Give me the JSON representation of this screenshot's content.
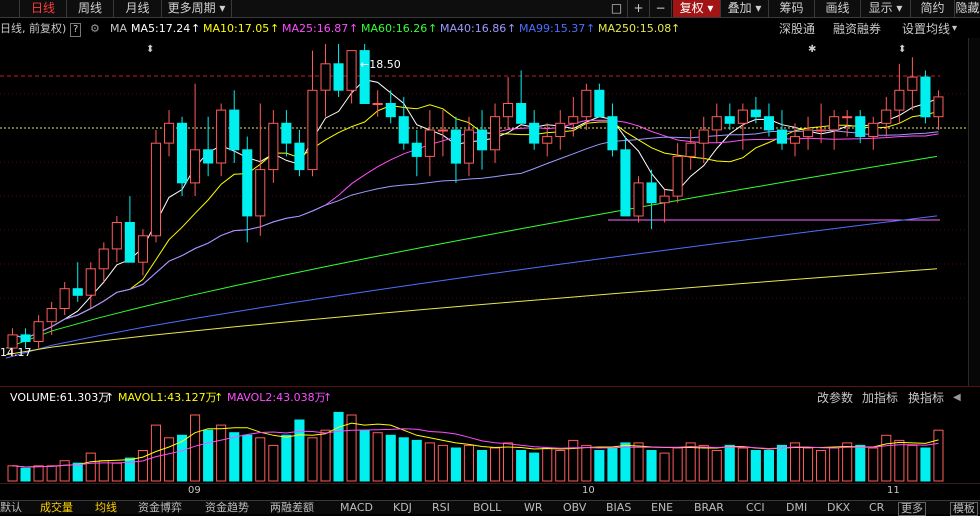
{
  "toolbar": {
    "left_cut": "",
    "tabs": [
      {
        "label": "日线",
        "active": true
      },
      {
        "label": "周线",
        "active": false
      },
      {
        "label": "月线",
        "active": false
      },
      {
        "label": "更多周期",
        "active": false
      }
    ],
    "more_arrow": "▾",
    "square_icon": "□",
    "plus": "+",
    "minus": "−",
    "fuquan": "复权",
    "dropdown_arrow": "▾",
    "overlay": "叠加",
    "chips": "筹码",
    "draw": "画线",
    "display": "显示",
    "simple": "简约",
    "hide": "隐藏"
  },
  "ma_legend": {
    "prefix": "日线, 前复权)",
    "help": "?",
    "label": "MA",
    "items": [
      {
        "text": "MA5:17.24",
        "color": "#ffffff"
      },
      {
        "text": "MA10:17.05",
        "color": "#ffff00"
      },
      {
        "text": "MA25:16.87",
        "color": "#ff4dff"
      },
      {
        "text": "MA60:16.26",
        "color": "#33ff33"
      },
      {
        "text": "MA40:16.86",
        "color": "#9b9bff"
      },
      {
        "text": "MA99:15.37",
        "color": "#4d6fff"
      },
      {
        "text": "MA250:15.08",
        "color": "#e8e84d"
      }
    ],
    "arrow": "↑",
    "right_links": [
      "深股通",
      "融资融券",
      "设置均线"
    ]
  },
  "price_labels": {
    "high": "18.50",
    "low": "14.17"
  },
  "volume_legend": {
    "volume": "VOLUME:61.303万",
    "mavol1": "MAVOL1:43.127万",
    "mavol2": "MAVOL2:43.038万",
    "links": [
      "改参数",
      "加指标",
      "换指标"
    ]
  },
  "dates": [
    "09",
    "10",
    "11"
  ],
  "bottom_tabs": [
    "默认",
    "成交量",
    "均线",
    "资金博弈",
    "资金趋势",
    "两融差额",
    "MACD",
    "KDJ",
    "RSI",
    "BOLL",
    "WR",
    "OBV",
    "BIAS",
    "ENE",
    "BRAR",
    "CCI",
    "DMI",
    "DKX",
    "CR",
    "更多",
    "模板"
  ],
  "bottom_active": [
    "成交量",
    "均线"
  ],
  "colors": {
    "up": "#ff5b5b",
    "down": "#00f0f0",
    "accent": "#a31414"
  },
  "chart_data": {
    "type": "candlestick",
    "ohlc": [
      [
        14.3,
        14.6,
        14.17,
        14.5
      ],
      [
        14.5,
        14.6,
        14.3,
        14.4
      ],
      [
        14.4,
        14.8,
        14.3,
        14.7
      ],
      [
        14.7,
        15.0,
        14.5,
        14.9
      ],
      [
        14.9,
        15.3,
        14.8,
        15.2
      ],
      [
        15.2,
        15.6,
        15.0,
        15.1
      ],
      [
        15.1,
        15.6,
        14.9,
        15.5
      ],
      [
        15.5,
        15.9,
        15.3,
        15.8
      ],
      [
        15.8,
        16.3,
        15.6,
        16.2
      ],
      [
        16.2,
        16.6,
        15.8,
        15.6
      ],
      [
        15.6,
        16.1,
        15.4,
        16.0
      ],
      [
        16.0,
        17.6,
        15.9,
        17.4
      ],
      [
        17.4,
        17.9,
        17.2,
        17.7
      ],
      [
        17.7,
        17.8,
        16.6,
        16.8
      ],
      [
        16.8,
        18.3,
        16.6,
        17.3
      ],
      [
        17.3,
        17.8,
        16.9,
        17.1
      ],
      [
        17.1,
        18.0,
        16.9,
        17.9
      ],
      [
        17.9,
        18.2,
        17.1,
        17.3
      ],
      [
        17.3,
        17.5,
        15.9,
        16.3
      ],
      [
        16.3,
        18.0,
        16.0,
        17.0
      ],
      [
        17.0,
        17.9,
        16.8,
        17.7
      ],
      [
        17.7,
        17.9,
        17.2,
        17.4
      ],
      [
        17.4,
        17.6,
        16.9,
        17.0
      ],
      [
        17.0,
        18.8,
        16.9,
        18.2
      ],
      [
        18.2,
        18.9,
        17.8,
        18.6
      ],
      [
        18.6,
        18.9,
        18.1,
        18.2
      ],
      [
        18.2,
        18.5,
        18.0,
        18.8
      ],
      [
        18.8,
        18.9,
        18.0,
        18.0
      ],
      [
        18.0,
        18.2,
        17.8,
        18.0
      ],
      [
        18.0,
        18.2,
        17.7,
        17.8
      ],
      [
        17.8,
        18.1,
        17.3,
        17.4
      ],
      [
        17.4,
        17.6,
        16.9,
        17.2
      ],
      [
        17.2,
        17.9,
        16.9,
        17.6
      ],
      [
        17.6,
        17.9,
        17.2,
        17.6
      ],
      [
        17.6,
        17.8,
        16.8,
        17.1
      ],
      [
        17.1,
        17.8,
        16.9,
        17.6
      ],
      [
        17.6,
        17.9,
        17.0,
        17.3
      ],
      [
        17.3,
        18.0,
        17.1,
        17.8
      ],
      [
        17.8,
        18.4,
        17.6,
        18.0
      ],
      [
        18.0,
        18.5,
        17.8,
        17.7
      ],
      [
        17.7,
        17.9,
        17.3,
        17.4
      ],
      [
        17.4,
        17.7,
        17.2,
        17.5
      ],
      [
        17.5,
        17.9,
        17.3,
        17.7
      ],
      [
        17.7,
        18.1,
        17.5,
        17.8
      ],
      [
        17.8,
        18.3,
        17.6,
        18.2
      ],
      [
        18.2,
        18.3,
        17.8,
        17.8
      ],
      [
        17.8,
        18.0,
        17.2,
        17.3
      ],
      [
        17.3,
        17.5,
        16.3,
        16.3
      ],
      [
        16.3,
        16.9,
        16.2,
        16.8
      ],
      [
        16.8,
        17.0,
        16.1,
        16.5
      ],
      [
        16.5,
        16.7,
        16.2,
        16.6
      ],
      [
        16.6,
        17.4,
        16.5,
        17.2
      ],
      [
        17.2,
        17.6,
        17.0,
        17.4
      ],
      [
        17.4,
        17.8,
        17.1,
        17.6
      ],
      [
        17.6,
        18.0,
        17.4,
        17.8
      ],
      [
        17.8,
        18.0,
        17.6,
        17.7
      ],
      [
        17.7,
        18.0,
        17.3,
        17.9
      ],
      [
        17.9,
        18.1,
        17.7,
        17.8
      ],
      [
        17.8,
        18.0,
        17.5,
        17.6
      ],
      [
        17.6,
        17.9,
        17.3,
        17.4
      ],
      [
        17.4,
        17.7,
        17.2,
        17.5
      ],
      [
        17.5,
        17.8,
        17.3,
        17.6
      ],
      [
        17.6,
        18.0,
        17.4,
        17.6
      ],
      [
        17.6,
        17.9,
        17.3,
        17.8
      ],
      [
        17.8,
        17.9,
        17.5,
        17.8
      ],
      [
        17.8,
        17.9,
        17.4,
        17.5
      ],
      [
        17.5,
        17.8,
        17.3,
        17.7
      ],
      [
        17.7,
        18.1,
        17.5,
        17.9
      ],
      [
        17.9,
        18.6,
        17.7,
        18.2
      ],
      [
        18.2,
        18.7,
        17.9,
        18.4
      ],
      [
        18.4,
        18.5,
        17.7,
        17.8
      ],
      [
        17.8,
        18.2,
        17.6,
        18.1
      ]
    ],
    "ylim": [
      14.0,
      18.9
    ],
    "volume_unit": "万",
    "volume": [
      6,
      5,
      6,
      6,
      8,
      7,
      11,
      8,
      7,
      9,
      12,
      22,
      17,
      18,
      26,
      20,
      22,
      19,
      18,
      17,
      14,
      18,
      24,
      17,
      20,
      27,
      26,
      20,
      19,
      18,
      17,
      16,
      15,
      14,
      13,
      14,
      12,
      13,
      15,
      12,
      11,
      13,
      12,
      16,
      14,
      12,
      13,
      15,
      15,
      12,
      11,
      13,
      15,
      14,
      12,
      14,
      13,
      12,
      12,
      14,
      15,
      13,
      12,
      13,
      15,
      14,
      13,
      18,
      16,
      14,
      13,
      20
    ]
  }
}
